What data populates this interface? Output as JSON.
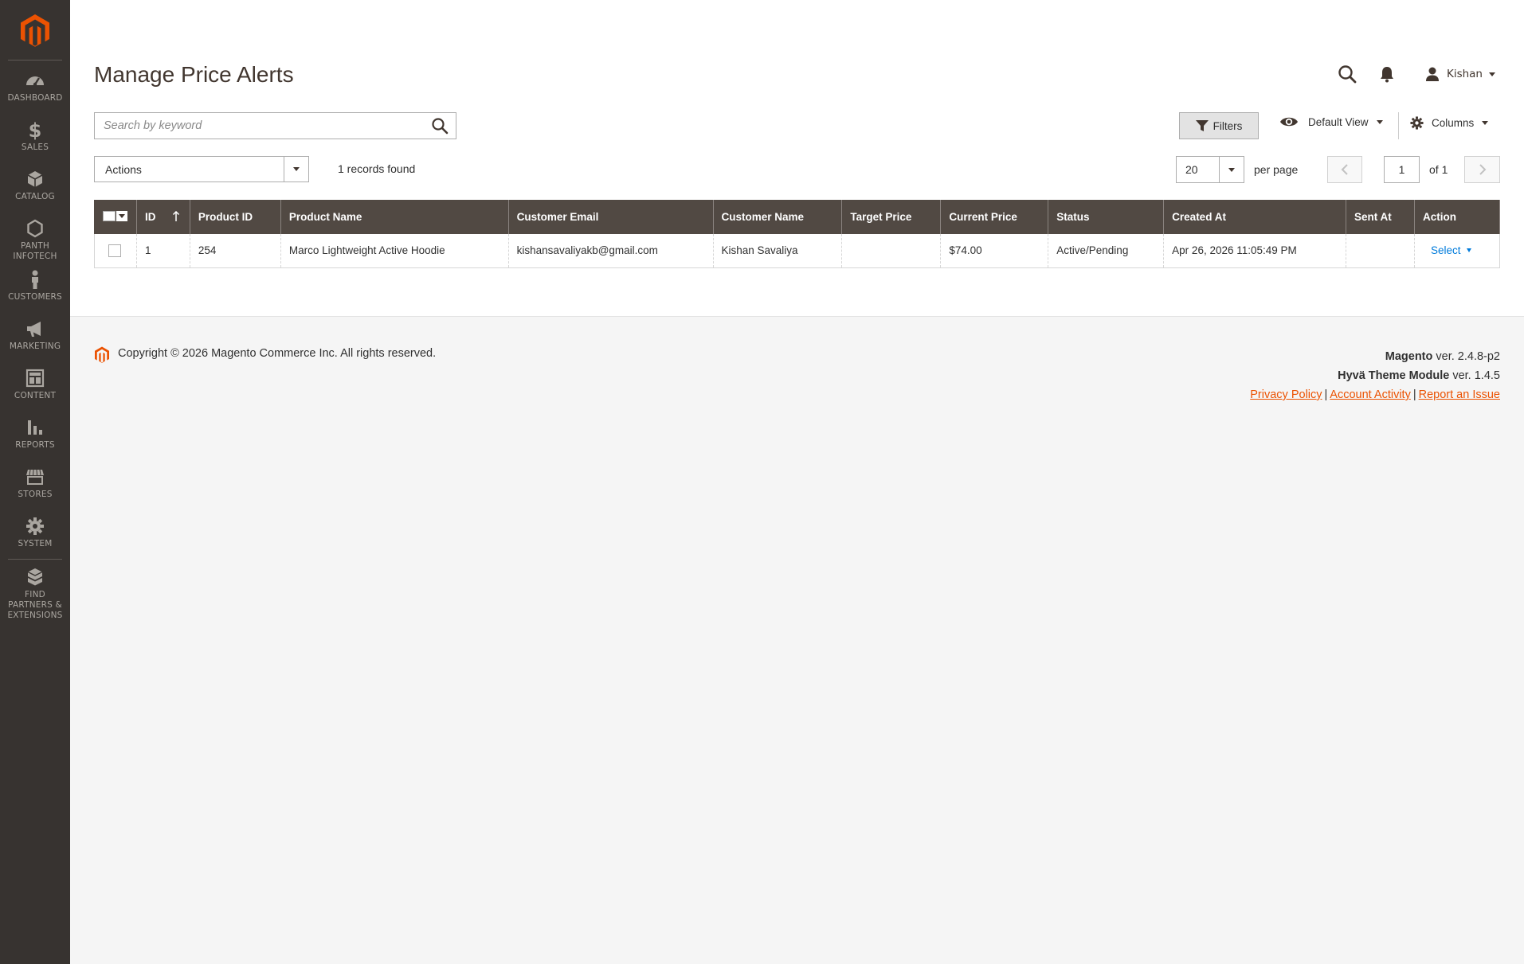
{
  "sidebar": {
    "items": [
      {
        "label": "DASHBOARD",
        "icon": "dashboard-icon"
      },
      {
        "label": "SALES",
        "icon": "dollar-icon"
      },
      {
        "label": "CATALOG",
        "icon": "cube-icon"
      },
      {
        "label": "PANTH INFOTECH",
        "icon": "hexagon-icon"
      },
      {
        "label": "CUSTOMERS",
        "icon": "person-icon"
      },
      {
        "label": "MARKETING",
        "icon": "megaphone-icon"
      },
      {
        "label": "CONTENT",
        "icon": "layout-icon"
      },
      {
        "label": "REPORTS",
        "icon": "bar-chart-icon"
      },
      {
        "label": "STORES",
        "icon": "storefront-icon"
      },
      {
        "label": "SYSTEM",
        "icon": "gear-icon"
      },
      {
        "label": "FIND PARTNERS & EXTENSIONS",
        "icon": "boxes-icon"
      }
    ]
  },
  "header": {
    "title": "Manage Price Alerts",
    "user_name": "Kishan"
  },
  "toolbar": {
    "search_placeholder": "Search by keyword",
    "filters_label": "Filters",
    "view_label": "Default View",
    "columns_label": "Columns",
    "actions_label": "Actions",
    "records_found": "1 records found",
    "per_page_value": "20",
    "per_page_label": "per page",
    "page_current": "1",
    "page_of": "of 1"
  },
  "grid": {
    "columns": [
      "ID",
      "Product ID",
      "Product Name",
      "Customer Email",
      "Customer Name",
      "Target Price",
      "Current Price",
      "Status",
      "Created At",
      "Sent At",
      "Action"
    ],
    "rows": [
      {
        "id": "1",
        "product_id": "254",
        "product_name": "Marco Lightweight Active Hoodie",
        "customer_email": "kishansavaliyakb@gmail.com",
        "customer_name": "Kishan Savaliya",
        "target_price": "",
        "current_price": "$74.00",
        "status": "Active/Pending",
        "created_at": "Apr 26, 2026 11:05:49 PM",
        "sent_at": "",
        "action": "Select"
      }
    ]
  },
  "footer": {
    "copyright": "Copyright © 2026 Magento Commerce Inc. All rights reserved.",
    "magento_name": "Magento",
    "magento_version": " ver. 2.4.8-p2",
    "hyva_name": "Hyvä Theme Module",
    "hyva_version": " ver. 1.4.5",
    "links": [
      "Privacy Policy",
      "Account Activity",
      "Report an Issue"
    ]
  },
  "colors": {
    "sidebar_bg": "#373330",
    "grid_header_bg": "#514943",
    "brand_orange": "#eb5202",
    "link_blue": "#007bdb"
  }
}
